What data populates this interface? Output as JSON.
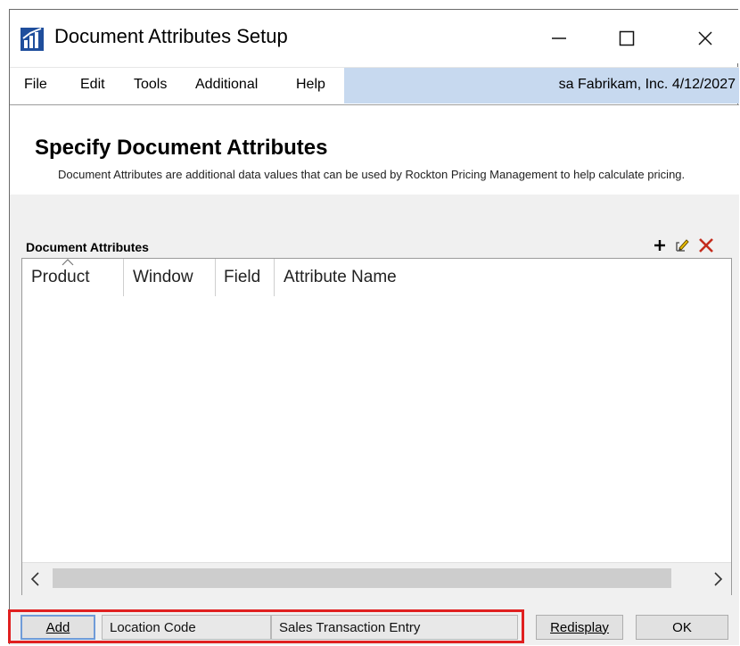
{
  "window": {
    "title": "Document Attributes Setup",
    "icon": "bar-chart-app-icon"
  },
  "menu": {
    "items": [
      "File",
      "Edit",
      "Tools",
      "Additional",
      "Help"
    ],
    "user_info": "sa  Fabrikam, Inc.  4/12/2027"
  },
  "header": {
    "title": "Specify Document Attributes",
    "description": "Document Attributes are additional data values that can be used by Rockton Pricing Management to help calculate pricing."
  },
  "grid": {
    "label": "Document Attributes",
    "columns": [
      "Product",
      "Window",
      "Field",
      "Attribute Name"
    ],
    "rows": []
  },
  "bottom": {
    "add_label": "Add",
    "location_value": "Location Code",
    "window_value": "Sales Transaction Entry",
    "redisplay_label": "Redisplay",
    "ok_label": "OK"
  },
  "colors": {
    "user_bar": "#c7d9ef",
    "highlight": "#e02020",
    "delete_icon": "#c42b1c"
  }
}
